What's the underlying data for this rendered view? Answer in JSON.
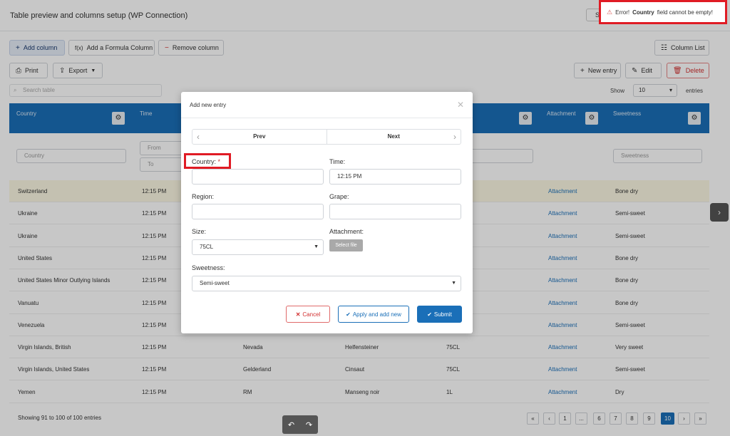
{
  "page": {
    "title": "Table preview and columns setup (WP Connection)",
    "hidden_button_label": "S"
  },
  "toast": {
    "prefix": "Error!",
    "field": "Country",
    "suffix": "field cannot be empty!"
  },
  "toolbar": {
    "add_column": "Add column",
    "add_formula_column": "Add a Formula Column",
    "remove_column": "Remove column",
    "column_list": "Column List",
    "print": "Print",
    "export": "Export",
    "new_entry": "New entry",
    "edit": "Edit",
    "delete": "Delete"
  },
  "search": {
    "placeholder": "Search table"
  },
  "show": {
    "label": "Show",
    "value": "10",
    "entries_label": "entries"
  },
  "table": {
    "headers": [
      "Country",
      "Time",
      "Attachment",
      "Sweetness"
    ],
    "filters": {
      "country": "Country",
      "time_from": "From",
      "time_to": "To",
      "sweetness": "Sweetness"
    },
    "rows": [
      {
        "country": "Switzerland",
        "time": "12:15 PM",
        "region": "",
        "grape": "",
        "size": "",
        "attachment": "Attachment",
        "sweetness": "Bone dry"
      },
      {
        "country": "Ukraine",
        "time": "12:15 PM",
        "region": "",
        "grape": "",
        "size": "",
        "attachment": "Attachment",
        "sweetness": "Semi-sweet"
      },
      {
        "country": "Ukraine",
        "time": "12:15 PM",
        "region": "",
        "grape": "",
        "size": "",
        "attachment": "Attachment",
        "sweetness": "Semi-sweet"
      },
      {
        "country": "United States",
        "time": "12:15 PM",
        "region": "",
        "grape": "",
        "size": "",
        "attachment": "Attachment",
        "sweetness": "Bone dry"
      },
      {
        "country": "United States Minor Outlying Islands",
        "time": "12:15 PM",
        "region": "",
        "grape": "",
        "size": "",
        "attachment": "Attachment",
        "sweetness": "Bone dry"
      },
      {
        "country": "Vanuatu",
        "time": "12:15 PM",
        "region": "",
        "grape": "",
        "size": "",
        "attachment": "Attachment",
        "sweetness": "Bone dry"
      },
      {
        "country": "Venezuela",
        "time": "12:15 PM",
        "region": "",
        "grape": "",
        "size": "",
        "attachment": "Attachment",
        "sweetness": "Semi-sweet"
      },
      {
        "country": "Virgin Islands, British",
        "time": "12:15 PM",
        "region": "Nevada",
        "grape": "Helfensteiner",
        "size": "75CL",
        "attachment": "Attachment",
        "sweetness": "Very sweet"
      },
      {
        "country": "Virgin Islands, United States",
        "time": "12:15 PM",
        "region": "Gelderland",
        "grape": "Cinsaut",
        "size": "75CL",
        "attachment": "Attachment",
        "sweetness": "Semi-sweet"
      },
      {
        "country": "Yemen",
        "time": "12:15 PM",
        "region": "RM",
        "grape": "Manseng noir",
        "size": "1L",
        "attachment": "Attachment",
        "sweetness": "Dry"
      }
    ]
  },
  "footer": {
    "info": "Showing 91 to 100 of 100 entries",
    "pages": [
      "«",
      "‹",
      "1",
      "...",
      "6",
      "7",
      "8",
      "9",
      "10",
      "›",
      "»"
    ],
    "active_page": "10"
  },
  "modal": {
    "title": "Add new entry",
    "prev": "Prev",
    "next": "Next",
    "fields": {
      "country_label": "Country:",
      "country_required": "*",
      "country_value": "",
      "time_label": "Time:",
      "time_value": "12:15 PM",
      "region_label": "Region:",
      "region_value": "",
      "grape_label": "Grape:",
      "grape_value": "",
      "size_label": "Size:",
      "size_value": "75CL",
      "attachment_label": "Attachment:",
      "select_file": "Select file",
      "sweetness_label": "Sweetness:",
      "sweetness_value": "Semi-sweet"
    },
    "buttons": {
      "cancel": "Cancel",
      "apply": "Apply and add new",
      "submit": "Submit"
    }
  },
  "colors": {
    "accent": "#1a6fb8",
    "danger": "#e01b24"
  }
}
